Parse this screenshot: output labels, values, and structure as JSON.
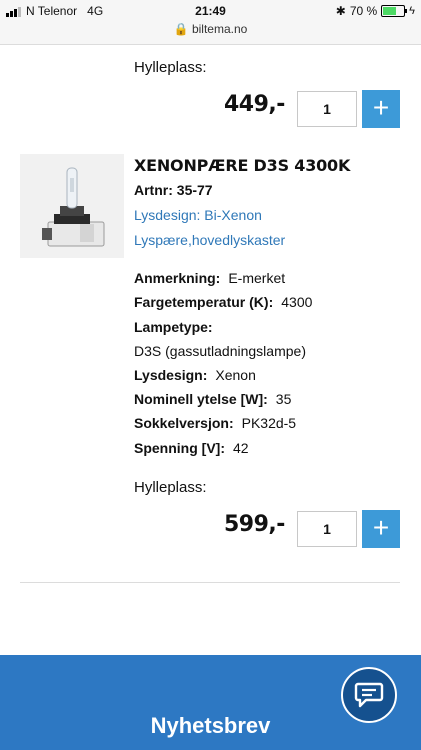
{
  "status_bar": {
    "carrier": "N Telenor",
    "network": "4G",
    "time": "21:49",
    "battery": "70 %",
    "battery_level": 0.7,
    "url": "biltema.no"
  },
  "prev_product": {
    "shelf_label": "Hylleplass:",
    "price": "449,-",
    "qty": "1",
    "add": "+"
  },
  "product": {
    "title": "XENONPÆRE D3S 4300K",
    "artnr_label": "Artnr:",
    "artnr": "35-77",
    "link1": "Lysdesign: Bi-Xenon",
    "link2": "Lyspære,hovedlyskaster",
    "specs": [
      {
        "key": "Anmerkning:",
        "val": "E-merket"
      },
      {
        "key": "Fargetemperatur (K):",
        "val": "4300"
      },
      {
        "key": "Lampetype:",
        "val": ""
      },
      {
        "key": "",
        "val": "D3S (gassutladningslampe)"
      },
      {
        "key": "Lysdesign:",
        "val": "Xenon"
      },
      {
        "key": "Nominell ytelse [W]:",
        "val": "35"
      },
      {
        "key": "Sokkelversjon:",
        "val": "PK32d-5"
      },
      {
        "key": "Spenning [V]:",
        "val": "42"
      }
    ],
    "shelf_label": "Hylleplass:",
    "price": "599,-",
    "qty": "1",
    "add": "+"
  },
  "footer": {
    "title": "Nyhetsbrev"
  },
  "icons": {
    "chat": "chat-bubble-icon",
    "lock": "lock-icon",
    "bluetooth": "bluetooth-icon"
  }
}
